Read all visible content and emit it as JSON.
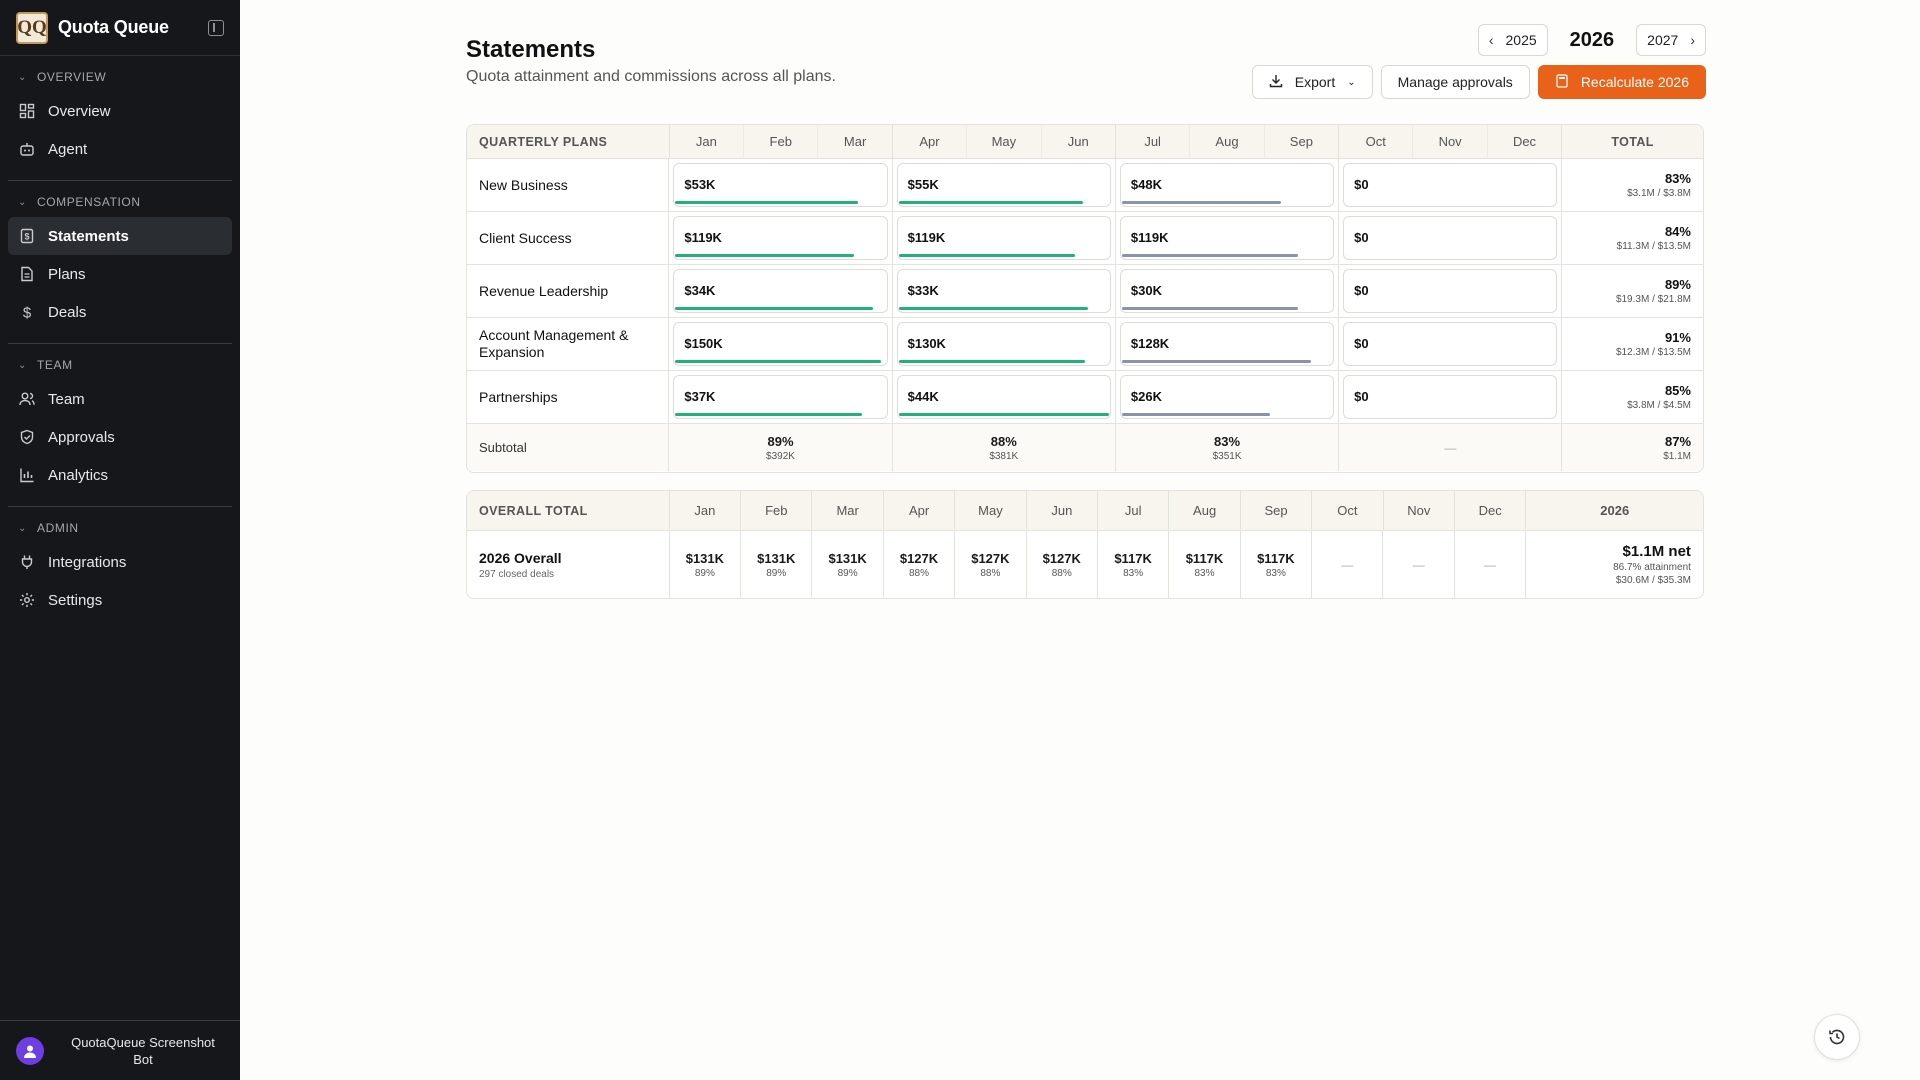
{
  "app": {
    "name": "Quota Queue",
    "logo_text": "QQ"
  },
  "sidebar": {
    "sections": [
      {
        "label": "OVERVIEW",
        "items": [
          {
            "label": "Overview",
            "icon": "dashboard-icon"
          },
          {
            "label": "Agent",
            "icon": "bot-icon"
          }
        ]
      },
      {
        "label": "COMPENSATION",
        "items": [
          {
            "label": "Statements",
            "icon": "receipt-icon",
            "active": true
          },
          {
            "label": "Plans",
            "icon": "document-icon"
          },
          {
            "label": "Deals",
            "icon": "dollar-icon"
          }
        ]
      },
      {
        "label": "TEAM",
        "items": [
          {
            "label": "Team",
            "icon": "users-icon"
          },
          {
            "label": "Approvals",
            "icon": "shield-check-icon"
          },
          {
            "label": "Analytics",
            "icon": "bar-chart-icon"
          }
        ]
      },
      {
        "label": "ADMIN",
        "items": [
          {
            "label": "Integrations",
            "icon": "plug-icon"
          },
          {
            "label": "Settings",
            "icon": "gear-icon"
          }
        ]
      }
    ],
    "user": {
      "name": "QuotaQueue Screenshot Bot"
    }
  },
  "page": {
    "title": "Statements",
    "subtitle": "Quota attainment and commissions across all plans.",
    "year_prev": "2025",
    "year_current": "2026",
    "year_next": "2027",
    "export_label": "Export",
    "manage_label": "Manage approvals",
    "recalc_label": "Recalculate 2026"
  },
  "quarterly": {
    "header_label": "QUARTERLY PLANS",
    "months": [
      "Jan",
      "Feb",
      "Mar",
      "Apr",
      "May",
      "Jun",
      "Jul",
      "Aug",
      "Sep",
      "Oct",
      "Nov",
      "Dec"
    ],
    "total_label": "TOTAL",
    "rows": [
      {
        "name": "New Business",
        "quarters": [
          {
            "value": "$53K",
            "progress": 0.86,
            "color": "#22b07d"
          },
          {
            "value": "$55K",
            "progress": 0.87,
            "color": "#22b07d"
          },
          {
            "value": "$48K",
            "progress": 0.75,
            "color": "#8a93a8"
          },
          {
            "value": "$0",
            "progress": 0,
            "color": "#8a93a8"
          }
        ],
        "pct": "83%",
        "amt": "$3.1M / $3.8M"
      },
      {
        "name": "Client Success",
        "quarters": [
          {
            "value": "$119K",
            "progress": 0.84,
            "color": "#22b07d"
          },
          {
            "value": "$119K",
            "progress": 0.83,
            "color": "#22b07d"
          },
          {
            "value": "$119K",
            "progress": 0.83,
            "color": "#8a93a8"
          },
          {
            "value": "$0",
            "progress": 0,
            "color": "#8a93a8"
          }
        ],
        "pct": "84%",
        "amt": "$11.3M / $13.5M"
      },
      {
        "name": "Revenue Leadership",
        "quarters": [
          {
            "value": "$34K",
            "progress": 0.93,
            "color": "#22b07d"
          },
          {
            "value": "$33K",
            "progress": 0.89,
            "color": "#22b07d"
          },
          {
            "value": "$30K",
            "progress": 0.83,
            "color": "#8a93a8"
          },
          {
            "value": "$0",
            "progress": 0,
            "color": "#8a93a8"
          }
        ],
        "pct": "89%",
        "amt": "$19.3M / $21.8M"
      },
      {
        "name": "Account Management & Expansion",
        "quarters": [
          {
            "value": "$150K",
            "progress": 0.97,
            "color": "#22b07d"
          },
          {
            "value": "$130K",
            "progress": 0.88,
            "color": "#22b07d"
          },
          {
            "value": "$128K",
            "progress": 0.89,
            "color": "#8a93a8"
          },
          {
            "value": "$0",
            "progress": 0,
            "color": "#8a93a8"
          }
        ],
        "pct": "91%",
        "amt": "$12.3M / $13.5M"
      },
      {
        "name": "Partnerships",
        "quarters": [
          {
            "value": "$37K",
            "progress": 0.88,
            "color": "#22b07d"
          },
          {
            "value": "$44K",
            "progress": 0.99,
            "color": "#22b07d"
          },
          {
            "value": "$26K",
            "progress": 0.7,
            "color": "#8a93a8"
          },
          {
            "value": "$0",
            "progress": 0,
            "color": "#8a93a8"
          }
        ],
        "pct": "85%",
        "amt": "$3.8M / $4.5M"
      }
    ],
    "subtotal": {
      "label": "Subtotal",
      "quarters": [
        {
          "pct": "89%",
          "amt": "$392K"
        },
        {
          "pct": "88%",
          "amt": "$381K"
        },
        {
          "pct": "83%",
          "amt": "$351K"
        },
        {
          "dash": "—"
        }
      ],
      "total_pct": "87%",
      "total_amt": "$1.1M"
    }
  },
  "overall": {
    "header_label": "OVERALL TOTAL",
    "year_label": "2026",
    "name": "2026 Overall",
    "sub": "297 closed deals",
    "months": [
      {
        "v": "$131K",
        "p": "89%"
      },
      {
        "v": "$131K",
        "p": "89%"
      },
      {
        "v": "$131K",
        "p": "89%"
      },
      {
        "v": "$127K",
        "p": "88%"
      },
      {
        "v": "$127K",
        "p": "88%"
      },
      {
        "v": "$127K",
        "p": "88%"
      },
      {
        "v": "$117K",
        "p": "83%"
      },
      {
        "v": "$117K",
        "p": "83%"
      },
      {
        "v": "$117K",
        "p": "83%"
      },
      {
        "dash": "—"
      },
      {
        "dash": "—"
      },
      {
        "dash": "—"
      }
    ],
    "net": "$1.1M net",
    "attainment": "86.7% attainment",
    "ratio": "$30.6M / $35.3M"
  }
}
